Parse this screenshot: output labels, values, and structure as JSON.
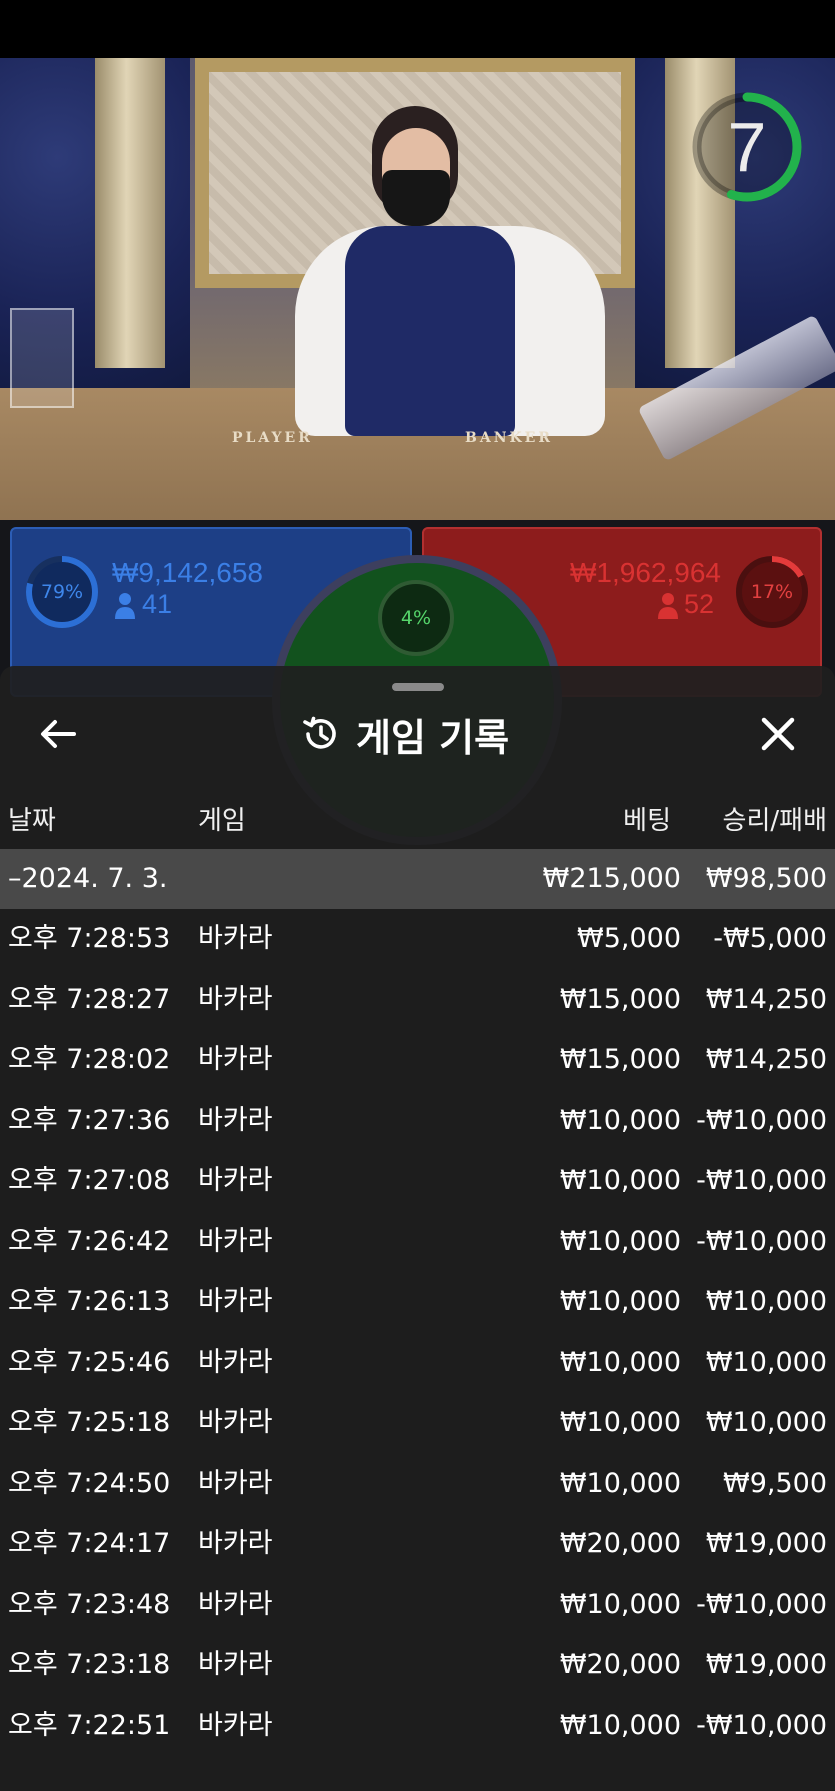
{
  "timer": {
    "value": "7",
    "progress": 0.55,
    "color": "#22b24c"
  },
  "table_labels": {
    "player": "PLAYER",
    "banker": "BANKER"
  },
  "player_spot": {
    "percent": "79%",
    "percent_value": 0.79,
    "amount": "₩9,142,658",
    "players": "41",
    "color": "#2c6fd6"
  },
  "banker_spot": {
    "percent": "17%",
    "percent_value": 0.17,
    "amount": "₩1,962,964",
    "players": "52",
    "color": "#e43b3b"
  },
  "tie_spot": {
    "percent": "4%",
    "percent_value": 0.04
  },
  "panel": {
    "title": "게임 기록",
    "icons": {
      "back": "arrow-left-icon",
      "history": "history-icon",
      "close": "close-icon"
    },
    "columns": {
      "date": "날짜",
      "game": "게임",
      "bet": "베팅",
      "result": "승리/패배"
    },
    "date_group": {
      "date": "–2024. 7. 3.",
      "bet": "₩215,000",
      "result": "₩98,500"
    },
    "rows": [
      {
        "time": "오후 7:28:53",
        "game": "바카라",
        "bet": "₩5,000",
        "result": "-₩5,000"
      },
      {
        "time": "오후 7:28:27",
        "game": "바카라",
        "bet": "₩15,000",
        "result": "₩14,250"
      },
      {
        "time": "오후 7:28:02",
        "game": "바카라",
        "bet": "₩15,000",
        "result": "₩14,250"
      },
      {
        "time": "오후 7:27:36",
        "game": "바카라",
        "bet": "₩10,000",
        "result": "-₩10,000"
      },
      {
        "time": "오후 7:27:08",
        "game": "바카라",
        "bet": "₩10,000",
        "result": "-₩10,000"
      },
      {
        "time": "오후 7:26:42",
        "game": "바카라",
        "bet": "₩10,000",
        "result": "-₩10,000"
      },
      {
        "time": "오후 7:26:13",
        "game": "바카라",
        "bet": "₩10,000",
        "result": "₩10,000"
      },
      {
        "time": "오후 7:25:46",
        "game": "바카라",
        "bet": "₩10,000",
        "result": "₩10,000"
      },
      {
        "time": "오후 7:25:18",
        "game": "바카라",
        "bet": "₩10,000",
        "result": "₩10,000"
      },
      {
        "time": "오후 7:24:50",
        "game": "바카라",
        "bet": "₩10,000",
        "result": "₩9,500"
      },
      {
        "time": "오후 7:24:17",
        "game": "바카라",
        "bet": "₩20,000",
        "result": "₩19,000"
      },
      {
        "time": "오후 7:23:48",
        "game": "바카라",
        "bet": "₩10,000",
        "result": "-₩10,000"
      },
      {
        "time": "오후 7:23:18",
        "game": "바카라",
        "bet": "₩20,000",
        "result": "₩19,000"
      },
      {
        "time": "오후 7:22:51",
        "game": "바카라",
        "bet": "₩10,000",
        "result": "-₩10,000"
      }
    ]
  }
}
